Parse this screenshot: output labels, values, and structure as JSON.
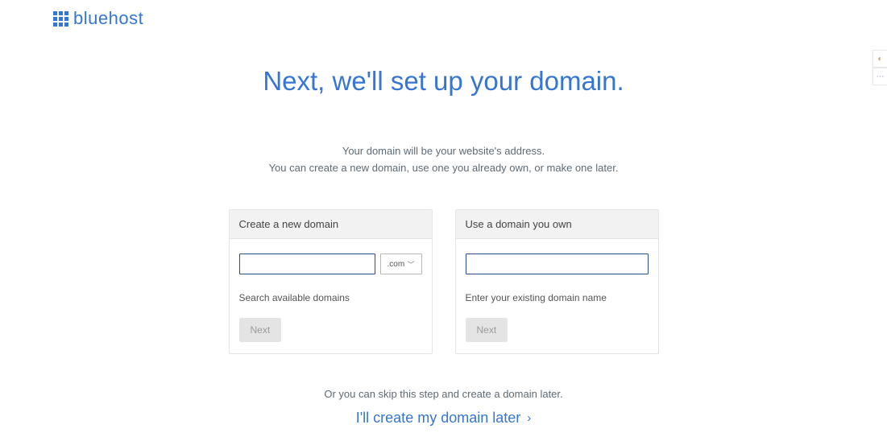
{
  "brand": {
    "name": "bluehost"
  },
  "headline": "Next, we'll set up your domain.",
  "sub1": "Your domain will be your website's address.",
  "sub2": "You can create a new domain, use one you already own, or make one later.",
  "create_card": {
    "title": "Create a new domain",
    "tld": ".com",
    "hint": "Search available domains",
    "next": "Next"
  },
  "own_card": {
    "title": "Use a domain you own",
    "hint": "Enter your existing domain name",
    "next": "Next"
  },
  "skip_text": "Or you can skip this step and create a domain later.",
  "skip_link": "I'll create my domain later"
}
